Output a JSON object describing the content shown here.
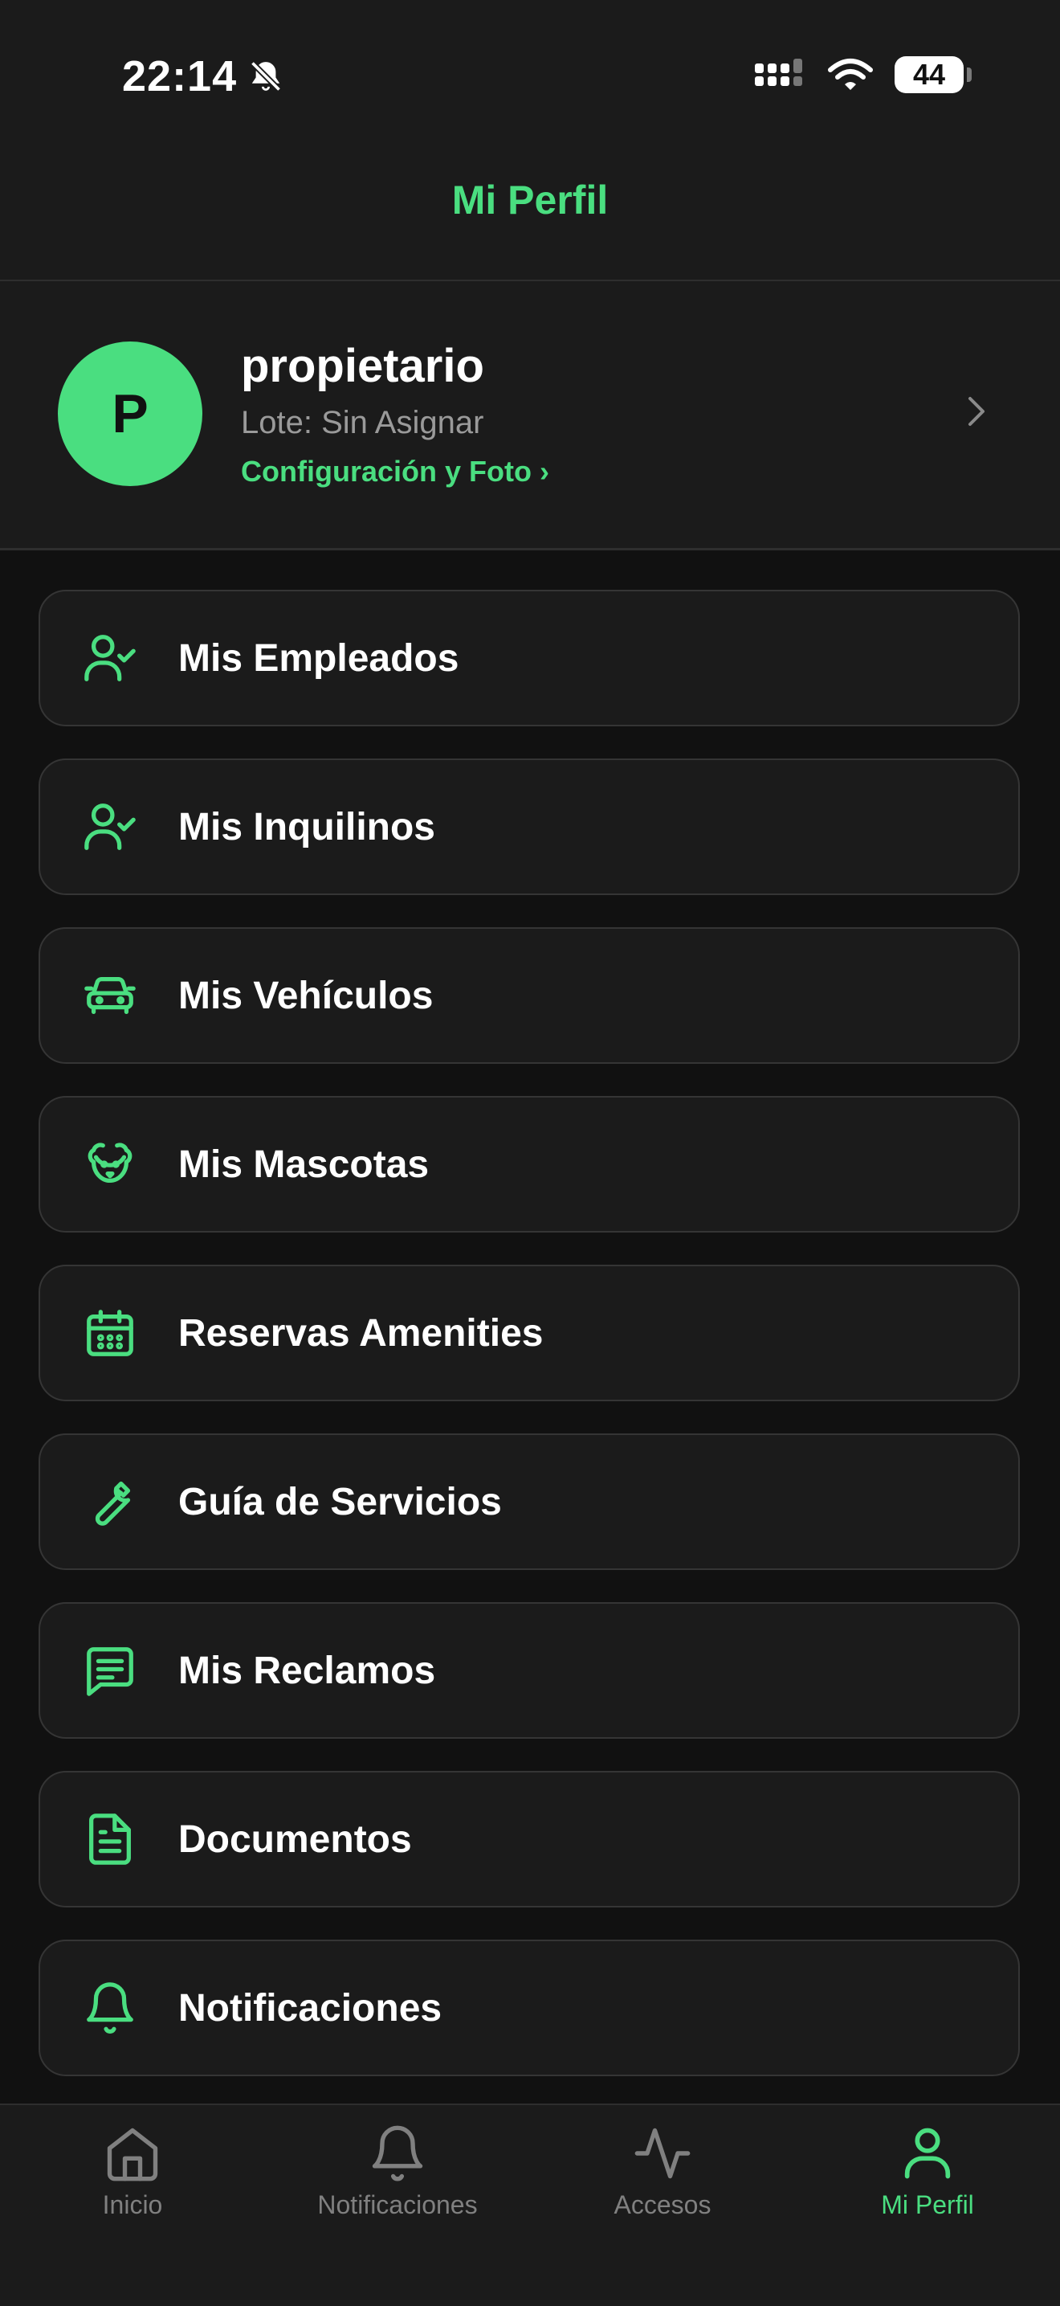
{
  "status_bar": {
    "time": "22:14",
    "battery": "44"
  },
  "header": {
    "title": "Mi Perfil"
  },
  "profile": {
    "avatar_letter": "P",
    "name": "propietario",
    "lote": "Lote: Sin Asignar",
    "config_link": "Configuración y Foto ›"
  },
  "menu": {
    "items": [
      {
        "label": "Mis Empleados",
        "icon": "user-check-icon"
      },
      {
        "label": "Mis Inquilinos",
        "icon": "user-check-icon"
      },
      {
        "label": "Mis Vehículos",
        "icon": "car-icon"
      },
      {
        "label": "Mis Mascotas",
        "icon": "dog-icon"
      },
      {
        "label": "Reservas Amenities",
        "icon": "calendar-icon"
      },
      {
        "label": "Guía de Servicios",
        "icon": "wrench-icon"
      },
      {
        "label": "Mis Reclamos",
        "icon": "message-icon"
      },
      {
        "label": "Documentos",
        "icon": "document-icon"
      },
      {
        "label": "Notificaciones",
        "icon": "bell-icon"
      }
    ]
  },
  "tabs": [
    {
      "label": "Inicio",
      "icon": "home-icon",
      "active": false
    },
    {
      "label": "Notificaciones",
      "icon": "bell-icon",
      "active": false
    },
    {
      "label": "Accesos",
      "icon": "activity-icon",
      "active": false
    },
    {
      "label": "Mi Perfil",
      "icon": "user-icon",
      "active": true
    }
  ],
  "colors": {
    "accent": "#4ade80",
    "background": "#111111",
    "surface": "#1b1b1b",
    "border": "#353535",
    "muted": "#9a9a9a"
  }
}
